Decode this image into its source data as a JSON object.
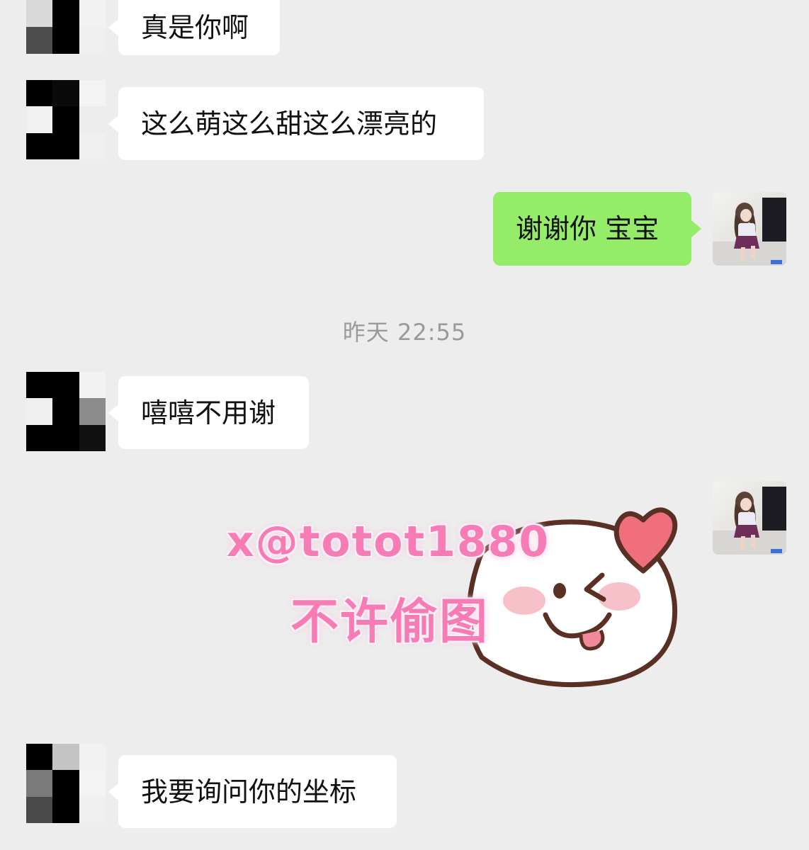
{
  "messages": [
    {
      "side": "in",
      "text": "真是你啊"
    },
    {
      "side": "in",
      "text": "这么萌这么甜这么漂亮的"
    },
    {
      "side": "out",
      "text": "谢谢你 宝宝"
    },
    {
      "side": "in",
      "text": "嘻嘻不用谢"
    },
    {
      "side": "out",
      "type": "sticker"
    },
    {
      "side": "in",
      "text": "我要询问你的坐标"
    }
  ],
  "timestamp": "昨天 22:55",
  "sticker": {
    "watermark_line1": "x@totot1880",
    "watermark_line2": "不许偷图"
  },
  "colors": {
    "background": "#ededed",
    "incoming_bubble": "#ffffff",
    "outgoing_bubble": "#95ec69",
    "timestamp": "#9a9a9a",
    "watermark": "#f77cb6",
    "heart": "#ef6f7d"
  }
}
